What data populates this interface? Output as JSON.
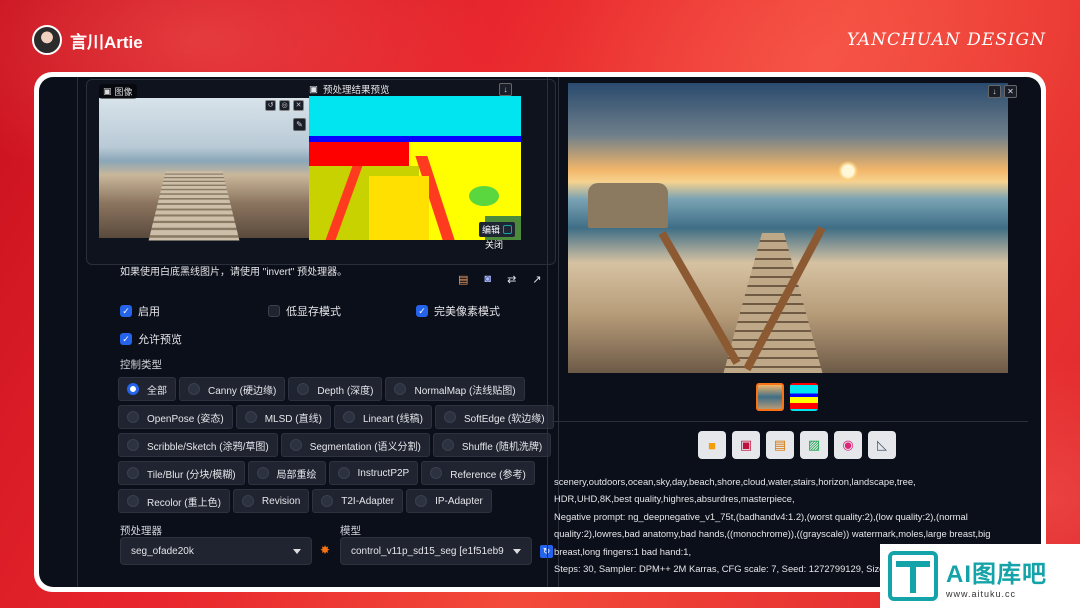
{
  "brand": {
    "name": "言川Artie",
    "right": "YANCHUAN DESIGN"
  },
  "controlnet": {
    "image_tag": "图像",
    "preview_title": "预处理结果预览",
    "edit_label": "编辑",
    "close_label": "关闭",
    "hint": "如果使用白底黑线图片，请使用 \"invert\" 预处理器。",
    "checkboxes": [
      {
        "label": "启用",
        "checked": true
      },
      {
        "label": "低显存模式",
        "checked": false
      },
      {
        "label": "完美像素模式",
        "checked": true
      },
      {
        "label": "允许预览",
        "checked": true
      }
    ],
    "control_type_label": "控制类型",
    "control_types": [
      [
        "全部",
        "Canny (硬边缘)",
        "Depth (深度)",
        "NormalMap (法线贴图)"
      ],
      [
        "OpenPose (姿态)",
        "MLSD (直线)",
        "Lineart (线稿)",
        "SoftEdge (软边缘)"
      ],
      [
        "Scribble/Sketch (涂鸦/草图)",
        "Segmentation (语义分割)",
        "Shuffle (随机洗牌)"
      ],
      [
        "Tile/Blur (分块/模糊)",
        "局部重绘",
        "InstructP2P",
        "Reference (参考)"
      ],
      [
        "Recolor (重上色)",
        "Revision",
        "T2I-Adapter",
        "IP-Adapter"
      ]
    ],
    "selected_type": "全部",
    "preprocessor_label": "预处理器",
    "preprocessor_value": "seg_ofade20k",
    "model_label": "模型",
    "model_value": "control_v11p_sd15_seg [e1f51eb9"
  },
  "output": {
    "prompt_lines": [
      "scenery,outdoors,ocean,sky,day,beach,shore,cloud,water,stairs,horizon,landscape,tree,",
      "HDR,UHD,8K,best quality,highres,absurdres,masterpiece,",
      "Negative prompt: ng_deepnegative_v1_75t,(badhandv4:1.2),(worst quality:2),(low quality:2),(normal quality:2),lowres,bad anatomy,bad hands,((monochrome)),((grayscale)) watermark,moles,large breast,big breast,long fingers:1 bad hand:1,",
      "Steps: 30, Sampler: DPM++ 2M Karras, CFG scale: 7, Seed: 1272799129, Size:"
    ],
    "actions": [
      "folder-icon",
      "save-icon",
      "zip-icon",
      "image-icon",
      "palette-icon",
      "ruler-icon"
    ]
  },
  "watermark": {
    "title": "AI图库吧",
    "url": "www.aituku.cc"
  }
}
